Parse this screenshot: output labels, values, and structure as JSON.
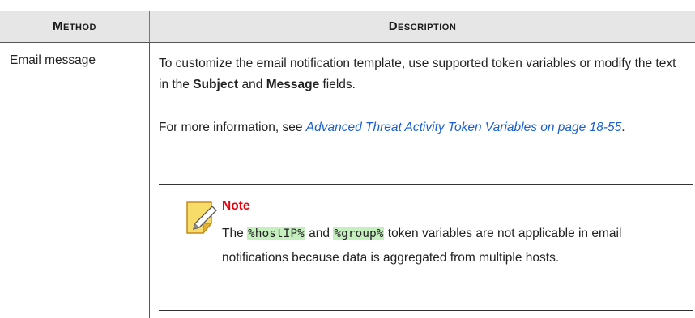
{
  "header": {
    "method": "Method",
    "description": "Description"
  },
  "row": {
    "method": "Email message",
    "para1": {
      "before": "To customize the email notification template, use supported token variables or modify the text in the ",
      "bold1": "Subject",
      "mid": " and ",
      "bold2": "Message",
      "after": " fields."
    },
    "para2": {
      "before": "For more information, see ",
      "link": "Advanced Threat Activity Token Variables on page 18-55",
      "after": "."
    },
    "note": {
      "label": "Note",
      "t1": "The ",
      "token1": "%hostIP%",
      "t2": " and ",
      "token2": "%group%",
      "t3": " token variables are not applicable in email notifications because data is aggregated from multiple hosts."
    }
  },
  "colors": {
    "link": "#1a5fd1",
    "note_label": "#e8000b",
    "token_highlight": "#c6efc0",
    "header_bg": "#e6e6e6"
  },
  "icons": {
    "note": "note-pencil-icon"
  }
}
